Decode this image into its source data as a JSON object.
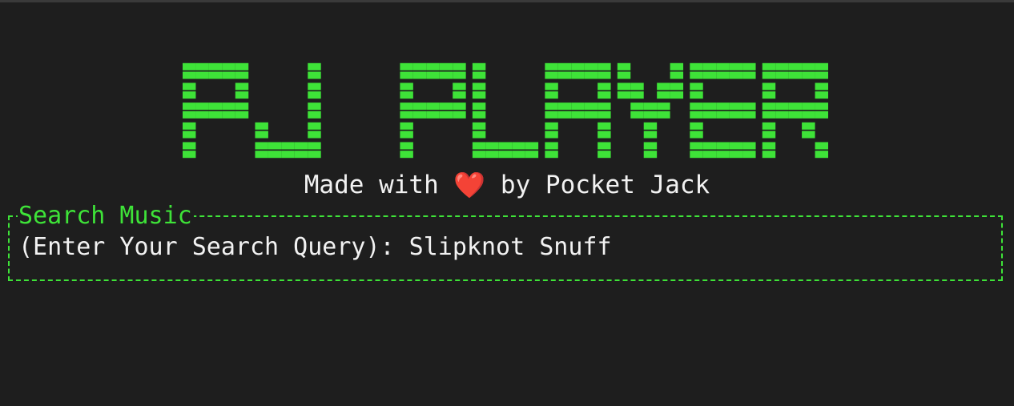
{
  "app": {
    "logo_text": "PJ PLAYER",
    "tagline_before": "Made with ",
    "tagline_heart": "❤️",
    "tagline_after": " by Pocket Jack"
  },
  "search": {
    "panel_title": "Search Music",
    "prompt": "(Enter Your Search Query): ",
    "query": "Slipknot Snuff"
  },
  "colors": {
    "background": "#1e1e1e",
    "accent": "#3ee338",
    "text": "#f2f2f2",
    "heart": "#e01b24"
  }
}
